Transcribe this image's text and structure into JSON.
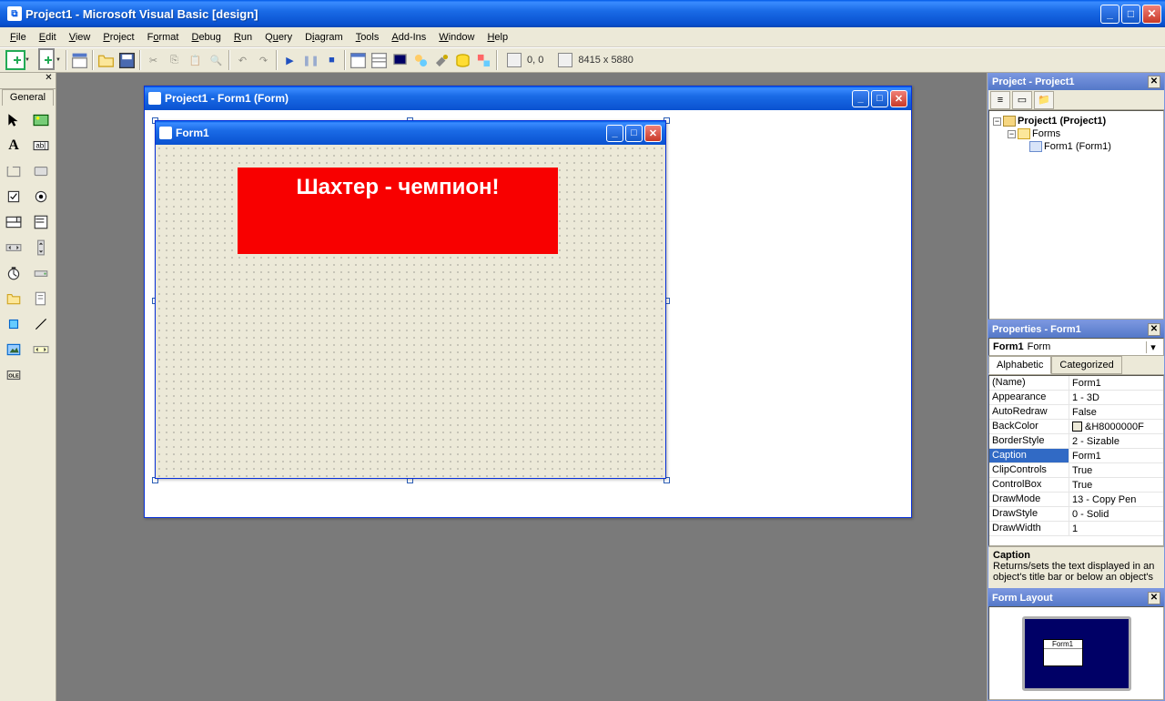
{
  "app": {
    "title": "Project1 - Microsoft Visual Basic [design]"
  },
  "menu": {
    "items": [
      "File",
      "Edit",
      "View",
      "Project",
      "Format",
      "Debug",
      "Run",
      "Query",
      "Diagram",
      "Tools",
      "Add-Ins",
      "Window",
      "Help"
    ]
  },
  "toolbar": {
    "coords": "0, 0",
    "size": "8415 x 5880"
  },
  "toolbox": {
    "tab": "General"
  },
  "designer": {
    "title": "Project1 - Form1 (Form)"
  },
  "form": {
    "title": "Form1",
    "label_text": "Шахтер -  чемпион!"
  },
  "project_panel": {
    "title": "Project - Project1",
    "root": "Project1 (Project1)",
    "folder": "Forms",
    "item": "Form1 (Form1)"
  },
  "props_panel": {
    "title": "Properties - Form1",
    "object_name": "Form1",
    "object_type": "Form",
    "tabs": [
      "Alphabetic",
      "Categorized"
    ],
    "rows": [
      {
        "n": "(Name)",
        "v": "Form1"
      },
      {
        "n": "Appearance",
        "v": "1 - 3D"
      },
      {
        "n": "AutoRedraw",
        "v": "False"
      },
      {
        "n": "BackColor",
        "v": "&H8000000F",
        "color": true
      },
      {
        "n": "BorderStyle",
        "v": "2 - Sizable"
      },
      {
        "n": "Caption",
        "v": "Form1",
        "sel": true
      },
      {
        "n": "ClipControls",
        "v": "True"
      },
      {
        "n": "ControlBox",
        "v": "True"
      },
      {
        "n": "DrawMode",
        "v": "13 - Copy Pen"
      },
      {
        "n": "DrawStyle",
        "v": "0 - Solid"
      },
      {
        "n": "DrawWidth",
        "v": "1"
      }
    ],
    "desc_title": "Caption",
    "desc_text": "Returns/sets the text displayed in an object's title bar or below an object's"
  },
  "layout_panel": {
    "title": "Form Layout",
    "form_label": "Form1"
  }
}
